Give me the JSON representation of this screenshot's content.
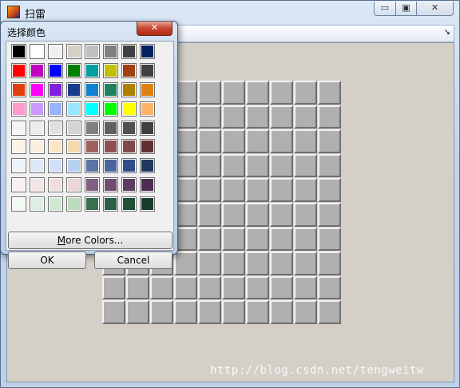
{
  "main_window": {
    "title": "扫雷",
    "minimize_label": "▭",
    "maximize_label": "▣",
    "close_label": "✕",
    "dock_arrow": "↘",
    "grid": {
      "rows": 10,
      "cols": 10,
      "cell_color": "#b0b0b0"
    }
  },
  "color_dialog": {
    "title": "选择颜色",
    "close_label": "✕",
    "swatches": [
      "#000000",
      "#ffffff",
      "#f0f0f0",
      "#d4d0c8",
      "#c0c0c0",
      "#808080",
      "#404040",
      "#002060",
      "#ff0000",
      "#c000c0",
      "#0000ff",
      "#008000",
      "#00a0a0",
      "#c0c000",
      "#a04010",
      "#404040",
      "#e04010",
      "#ff00ff",
      "#8020e0",
      "#1c3c8c",
      "#1080d0",
      "#208060",
      "#b08000",
      "#e08010",
      "#ff99cc",
      "#cc99ff",
      "#99b3ff",
      "#99e6ff",
      "#00ffff",
      "#00ff00",
      "#ffff00",
      "#ffb366",
      "#f5f5f5",
      "#ececec",
      "#e0e0e0",
      "#d4d4d4",
      "#808080",
      "#606060",
      "#505050",
      "#404040",
      "#fdf3e7",
      "#fbeedc",
      "#fde6c8",
      "#f5d8b0",
      "#a06060",
      "#905050",
      "#804848",
      "#603030",
      "#eef4fb",
      "#dde9f8",
      "#cfe0f8",
      "#b8d0f0",
      "#5c74a8",
      "#4c64a0",
      "#304c88",
      "#203860",
      "#f8f0f0",
      "#f3e6e6",
      "#f0dede",
      "#ecd6d6",
      "#806080",
      "#704c70",
      "#5c3c60",
      "#4c2c50",
      "#f2f8f2",
      "#dfeee2",
      "#d0e8d4",
      "#bcdcc0",
      "#387050",
      "#2c6044",
      "#205038",
      "#183c2c"
    ],
    "more_colors_label": "More Colors...",
    "ok_label": "OK",
    "cancel_label": "Cancel"
  },
  "watermark": "http://blog.csdn.net/tengweitw"
}
